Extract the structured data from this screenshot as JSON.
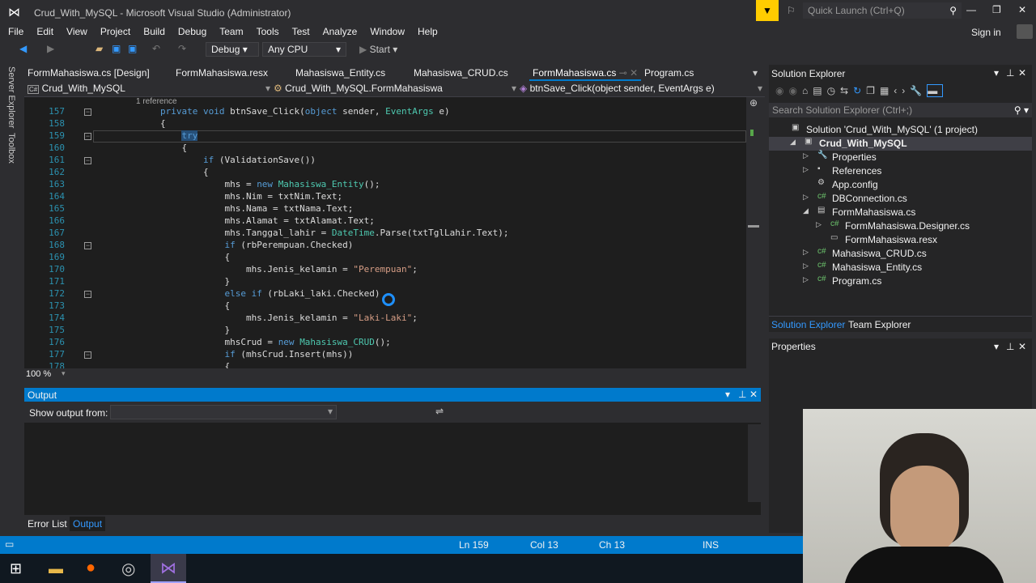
{
  "window": {
    "title": "Crud_With_MySQL - Microsoft Visual Studio (Administrator)",
    "quick_launch": "Quick Launch (Ctrl+Q)",
    "sign_in": "Sign in"
  },
  "menu": [
    "File",
    "Edit",
    "View",
    "Project",
    "Build",
    "Debug",
    "Team",
    "Tools",
    "Test",
    "Analyze",
    "Window",
    "Help"
  ],
  "toolbar": {
    "config": "Debug",
    "platform": "Any CPU",
    "start": "Start"
  },
  "sidebar": {
    "server_explorer": "Server Explorer",
    "toolbox": "Toolbox"
  },
  "tabs": [
    "FormMahasiswa.cs [Design]",
    "FormMahasiswa.resx",
    "Mahasiswa_Entity.cs",
    "Mahasiswa_CRUD.cs",
    "FormMahasiswa.cs",
    "Program.cs"
  ],
  "active_tab": 4,
  "navbar": {
    "project": "Crud_With_MySQL",
    "class": "Crud_With_MySQL.FormMahasiswa",
    "member": "btnSave_Click(object sender, EventArgs e)"
  },
  "editor": {
    "ref_hint": "1 reference",
    "zoom": "100 %",
    "lines": [
      {
        "n": "157",
        "fold": true,
        "seg": [
          [
            "pl",
            "        "
          ],
          [
            "kw",
            "private void "
          ],
          [
            "pl",
            "btnSave_Click("
          ],
          [
            "kw",
            "object"
          ],
          [
            "pl",
            " sender, "
          ],
          [
            "ty",
            "EventArgs"
          ],
          [
            "pl",
            " e)"
          ]
        ]
      },
      {
        "n": "158",
        "seg": [
          [
            "pl",
            "        {"
          ]
        ]
      },
      {
        "n": "159",
        "fold": true,
        "seg": [
          [
            "pl",
            "            "
          ],
          [
            "kw",
            "try"
          ]
        ]
      },
      {
        "n": "160",
        "seg": [
          [
            "pl",
            "            {"
          ]
        ]
      },
      {
        "n": "161",
        "fold": true,
        "seg": [
          [
            "pl",
            "                "
          ],
          [
            "kw",
            "if"
          ],
          [
            "pl",
            " (ValidationSave())"
          ]
        ]
      },
      {
        "n": "162",
        "seg": [
          [
            "pl",
            "                {"
          ]
        ]
      },
      {
        "n": "163",
        "seg": [
          [
            "pl",
            "                    mhs = "
          ],
          [
            "kw",
            "new "
          ],
          [
            "ty",
            "Mahasiswa_Entity"
          ],
          [
            "pl",
            "();"
          ]
        ]
      },
      {
        "n": "164",
        "seg": [
          [
            "pl",
            "                    mhs.Nim = txtNim.Text;"
          ]
        ]
      },
      {
        "n": "165",
        "seg": [
          [
            "pl",
            "                    mhs.Nama = txtNama.Text;"
          ]
        ]
      },
      {
        "n": "166",
        "seg": [
          [
            "pl",
            "                    mhs.Alamat = txtAlamat.Text;"
          ]
        ]
      },
      {
        "n": "167",
        "seg": [
          [
            "pl",
            "                    mhs.Tanggal_lahir = "
          ],
          [
            "ty",
            "DateTime"
          ],
          [
            "pl",
            ".Parse(txtTglLahir.Text);"
          ]
        ]
      },
      {
        "n": "168",
        "fold": true,
        "seg": [
          [
            "pl",
            "                    "
          ],
          [
            "kw",
            "if"
          ],
          [
            "pl",
            " (rbPerempuan.Checked)"
          ]
        ]
      },
      {
        "n": "169",
        "seg": [
          [
            "pl",
            "                    {"
          ]
        ]
      },
      {
        "n": "170",
        "seg": [
          [
            "pl",
            "                        mhs.Jenis_kelamin = "
          ],
          [
            "st",
            "\"Perempuan\""
          ],
          [
            "pl",
            ";"
          ]
        ]
      },
      {
        "n": "171",
        "seg": [
          [
            "pl",
            "                    }"
          ]
        ]
      },
      {
        "n": "172",
        "fold": true,
        "seg": [
          [
            "pl",
            "                    "
          ],
          [
            "kw",
            "else if"
          ],
          [
            "pl",
            " (rbLaki_laki.Checked)"
          ]
        ]
      },
      {
        "n": "173",
        "seg": [
          [
            "pl",
            "                    {"
          ]
        ]
      },
      {
        "n": "174",
        "seg": [
          [
            "pl",
            "                        mhs.Jenis_kelamin = "
          ],
          [
            "st",
            "\"Laki-Laki\""
          ],
          [
            "pl",
            ";"
          ]
        ]
      },
      {
        "n": "175",
        "seg": [
          [
            "pl",
            "                    }"
          ]
        ]
      },
      {
        "n": "176",
        "seg": [
          [
            "pl",
            "                    mhsCrud = "
          ],
          [
            "kw",
            "new "
          ],
          [
            "ty",
            "Mahasiswa_CRUD"
          ],
          [
            "pl",
            "();"
          ]
        ]
      },
      {
        "n": "177",
        "fold": true,
        "seg": [
          [
            "pl",
            "                    "
          ],
          [
            "kw",
            "if"
          ],
          [
            "pl",
            " (mhsCrud.Insert(mhs))"
          ]
        ]
      },
      {
        "n": "178",
        "seg": [
          [
            "pl",
            "                    {"
          ]
        ]
      }
    ]
  },
  "output": {
    "title": "Output",
    "show_from": "Show output from:"
  },
  "bottom_tabs": [
    "Error List",
    "Output"
  ],
  "status": {
    "ln": "Ln 159",
    "col": "Col 13",
    "ch": "Ch 13",
    "mode": "INS"
  },
  "solution_explorer": {
    "title": "Solution Explorer",
    "search": "Search Solution Explorer (Ctrl+;)",
    "items": [
      {
        "label": "Solution 'Crud_With_MySQL' (1 project)",
        "depth": 0,
        "icon": "solution-icon"
      },
      {
        "label": "Crud_With_MySQL",
        "depth": 1,
        "icon": "csproj-icon",
        "expander": "◢",
        "bold": true
      },
      {
        "label": "Properties",
        "depth": 2,
        "icon": "wrench-icon",
        "expander": "▷"
      },
      {
        "label": "References",
        "depth": 2,
        "icon": "references-icon",
        "expander": "▷"
      },
      {
        "label": "App.config",
        "depth": 2,
        "icon": "config-icon"
      },
      {
        "label": "DBConnection.cs",
        "depth": 2,
        "icon": "csharp-icon",
        "expander": "▷"
      },
      {
        "label": "FormMahasiswa.cs",
        "depth": 2,
        "icon": "form-icon",
        "expander": "◢"
      },
      {
        "label": "FormMahasiswa.Designer.cs",
        "depth": 3,
        "icon": "csharp-icon",
        "expander": "▷"
      },
      {
        "label": "FormMahasiswa.resx",
        "depth": 3,
        "icon": "resx-icon"
      },
      {
        "label": "Mahasiswa_CRUD.cs",
        "depth": 2,
        "icon": "csharp-icon",
        "expander": "▷"
      },
      {
        "label": "Mahasiswa_Entity.cs",
        "depth": 2,
        "icon": "csharp-icon",
        "expander": "▷"
      },
      {
        "label": "Program.cs",
        "depth": 2,
        "icon": "csharp-icon",
        "expander": "▷"
      }
    ],
    "tabs": [
      "Solution Explorer",
      "Team Explorer"
    ]
  },
  "properties": {
    "title": "Properties"
  }
}
